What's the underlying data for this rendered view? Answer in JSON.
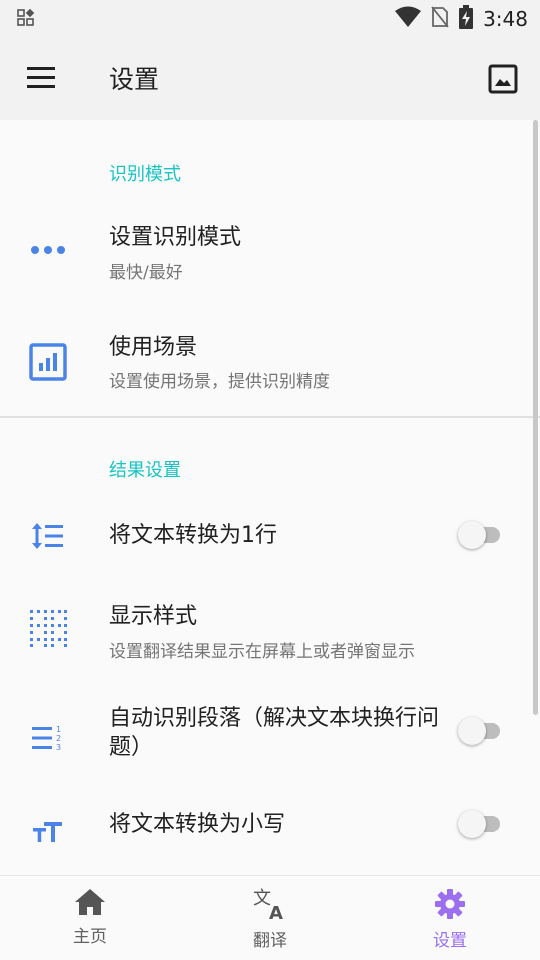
{
  "status_bar": {
    "time": "3:48"
  },
  "app_bar": {
    "title": "设置"
  },
  "sections": [
    {
      "title": "识别模式",
      "items": [
        {
          "title": "设置识别模式",
          "summary": "最快/最好",
          "icon": "more-horiz-icon"
        },
        {
          "title": "使用场景",
          "summary": "设置使用场景，提供识别精度",
          "icon": "bar-chart-icon"
        }
      ]
    },
    {
      "title": "结果设置",
      "items": [
        {
          "title": "将文本转换为1行",
          "icon": "line-spacing-icon",
          "switch": false
        },
        {
          "title": "显示样式",
          "summary": "设置翻译结果显示在屏幕上或者弹窗显示",
          "icon": "dotted-grid-icon"
        },
        {
          "title": "自动识别段落（解决文本块换行问题）",
          "icon": "numbered-list-icon",
          "switch": false
        },
        {
          "title": "将文本转换为小写",
          "icon": "text-size-icon",
          "switch": false
        }
      ]
    }
  ],
  "bottom_nav": {
    "items": [
      {
        "label": "主页",
        "icon": "home-icon",
        "active": false
      },
      {
        "label": "翻译",
        "icon": "translate-icon",
        "active": false
      },
      {
        "label": "设置",
        "icon": "settings-icon",
        "active": true
      }
    ]
  },
  "colors": {
    "accent": "#18c4c4",
    "icon": "#4a84e8",
    "nav_active": "#9c6ef0"
  }
}
